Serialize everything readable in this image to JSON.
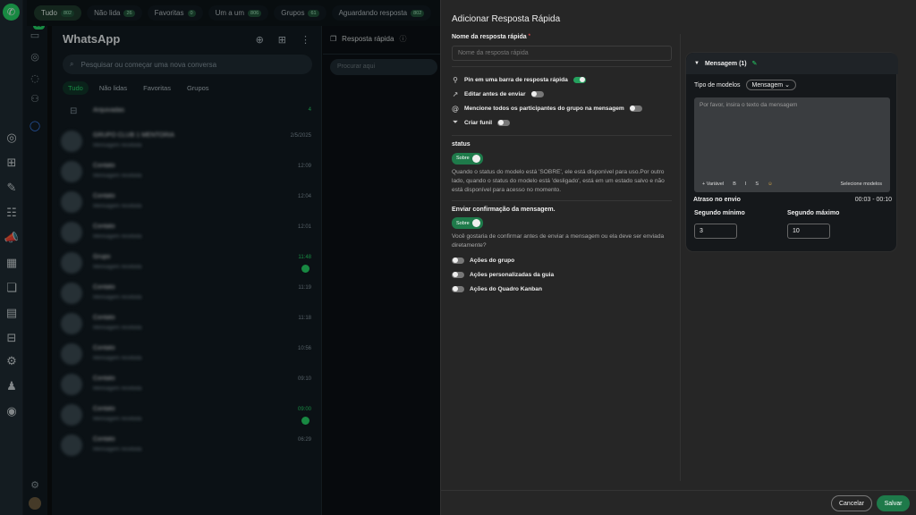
{
  "rail": {
    "logo_icon": "whatsapp-phone-icon"
  },
  "sidebar2": {
    "badge": "31"
  },
  "top_filters": [
    {
      "label": "Tudo",
      "count": "802",
      "active": true
    },
    {
      "label": "Não lida",
      "count": "26",
      "active": false
    },
    {
      "label": "Favoritas",
      "count": "0",
      "active": false
    },
    {
      "label": "Um a um",
      "count": "806",
      "active": false
    },
    {
      "label": "Grupos",
      "count": "61",
      "active": false
    },
    {
      "label": "Aguardando resposta",
      "count": "802",
      "active": false
    }
  ],
  "chatlist": {
    "title": "WhatsApp",
    "search_placeholder": "Pesquisar ou começar uma nova conversa",
    "filters": [
      "Tudo",
      "Não lidas",
      "Favoritas",
      "Grupos"
    ],
    "archived_label": "Arquivadas",
    "archived_count": "4",
    "chats": [
      {
        "name": "GRUPO CLUB 1 MENTORIA",
        "preview": "Mensagem recebida",
        "time": "2/5/2025",
        "unread": false
      },
      {
        "name": "Contato",
        "preview": "Mensagem recebida",
        "time": "12:09",
        "unread": false
      },
      {
        "name": "Contato",
        "preview": "Mensagem recebida",
        "time": "12:04",
        "unread": false
      },
      {
        "name": "Contato",
        "preview": "Mensagem recebida",
        "time": "12:01",
        "unread": false
      },
      {
        "name": "Grupo",
        "preview": "Mensagem recebida",
        "time": "11:48",
        "unread": true
      },
      {
        "name": "Contato",
        "preview": "Mensagem recebida",
        "time": "11:19",
        "unread": false
      },
      {
        "name": "Contato",
        "preview": "Mensagem recebida",
        "time": "11:18",
        "unread": false
      },
      {
        "name": "Contato",
        "preview": "Mensagem recebida",
        "time": "10:56",
        "unread": false
      },
      {
        "name": "Contato",
        "preview": "Mensagem recebida",
        "time": "09:10",
        "unread": false
      },
      {
        "name": "Contato",
        "preview": "Mensagem recebida",
        "time": "09:00",
        "unread": true
      },
      {
        "name": "Contato",
        "preview": "Mensagem recebida",
        "time": "06:29",
        "unread": false
      }
    ]
  },
  "quick_panel": {
    "title": "Resposta rápida",
    "search_placeholder": "Procurar aqui"
  },
  "modal": {
    "title": "Adicionar Resposta Rápida",
    "name_label": "Nome da resposta rápida",
    "name_required": "*",
    "name_placeholder": "Nome da resposta rápida",
    "options": [
      {
        "icon": "pin-icon",
        "glyph": "⚲",
        "label": "Pin em uma barra de resposta rápida",
        "on": true
      },
      {
        "icon": "arrow-up-right-icon",
        "glyph": "↗",
        "label": "Editar antes de enviar",
        "on": false
      },
      {
        "icon": "at-sign-icon",
        "glyph": "@",
        "label": "Mencione todos os participantes do grupo na mensagem",
        "on": false
      },
      {
        "icon": "funnel-icon",
        "glyph": "⏷",
        "label": "Criar funil",
        "on": false
      }
    ],
    "status_label": "status",
    "status_toggle": "Sobre",
    "status_desc": "Quando o status do modelo está 'SOBRE', ele está disponível para uso.Por outro lado, quando o status do modelo está 'desligado', está em um estado salvo e não está disponível para acesso no momento.",
    "confirm_label": "Enviar confirmação da mensagem.",
    "confirm_toggle": "Sobre",
    "confirm_desc": "Você gostaria de confirmar antes de enviar a mensagem ou ela deve ser enviada diretamente?",
    "actions": [
      "Ações do grupo",
      "Ações personalizadas da guia",
      "Ações do Quadro Kanban"
    ],
    "message": {
      "header": "Mensagem (1)",
      "type_label": "Tipo de modelos",
      "type_value": "Mensagem",
      "text_placeholder": "Por favor, insira o texto da mensagem",
      "tools": [
        "+ Variável",
        "B",
        "I",
        "S",
        "☺"
      ],
      "select_models": "Selecione modelos",
      "delay_label": "Atraso no envio",
      "delay_value": "00:03 - 00:10",
      "min_label": "Segundo mínimo",
      "min_value": "3",
      "max_label": "Segundo máximo",
      "max_value": "10"
    },
    "cancel": "Cancelar",
    "save": "Salvar"
  }
}
